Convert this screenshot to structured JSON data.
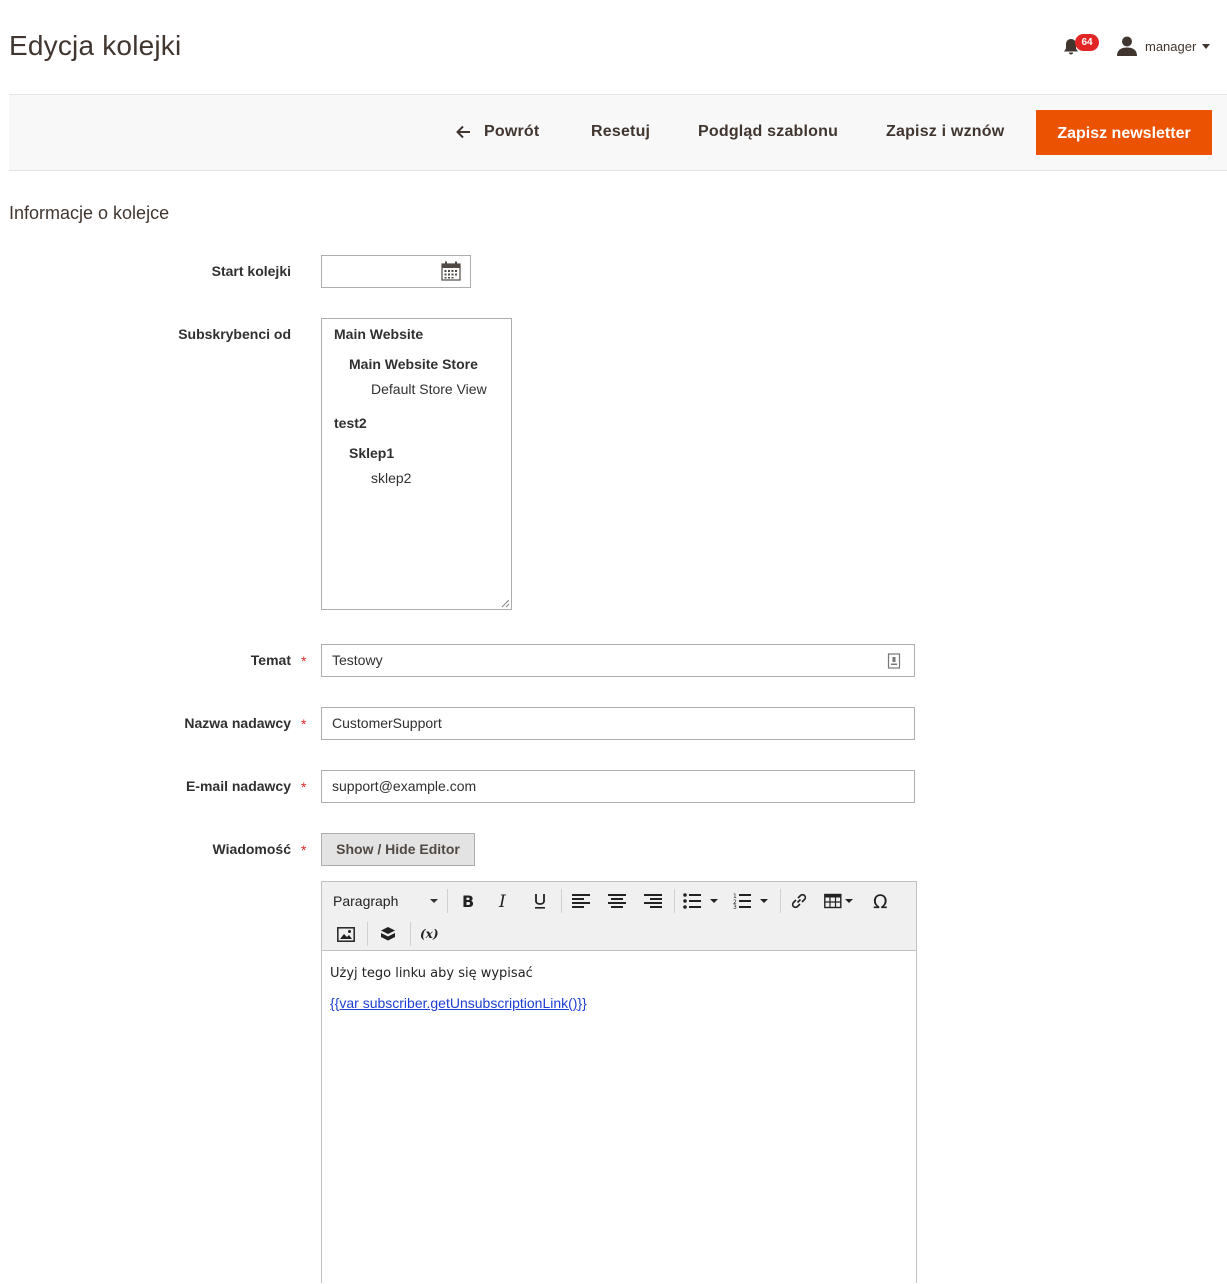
{
  "header": {
    "title": "Edycja kolejki",
    "notifications_count": "64",
    "user_name": "manager"
  },
  "actions": {
    "back": "Powrót",
    "reset": "Resetuj",
    "preview": "Podgląd szablonu",
    "save_continue": "Zapisz i wznów",
    "save_primary": "Zapisz newsletter"
  },
  "section": {
    "title": "Informacje o kolejce"
  },
  "form": {
    "queue_start": {
      "label": "Start kolejki",
      "value": ""
    },
    "subscribers_from": {
      "label": "Subskrybenci od",
      "items": [
        {
          "type": "website",
          "text": "Main Website"
        },
        {
          "type": "store",
          "text": "Main Website Store"
        },
        {
          "type": "view",
          "text": "Default Store View"
        },
        {
          "type": "website",
          "text": "test2"
        },
        {
          "type": "store",
          "text": "Sklep1"
        },
        {
          "type": "view",
          "text": "sklep2"
        }
      ]
    },
    "subject": {
      "label": "Temat",
      "value": "Testowy"
    },
    "sender_name": {
      "label": "Nazwa nadawcy",
      "value": "CustomerSupport"
    },
    "sender_email": {
      "label": "E-mail nadawcy",
      "value": "support@example.com"
    },
    "message": {
      "label": "Wiadomość",
      "toggle_label": "Show / Hide Editor"
    },
    "required_mark": "*"
  },
  "editor": {
    "format_value": "Paragraph",
    "toolbar_icons": [
      "bold-icon",
      "italic-icon",
      "underline-icon",
      "align-left-icon",
      "align-center-icon",
      "align-right-icon",
      "bullet-list-icon",
      "numbered-list-icon",
      "link-icon",
      "table-icon",
      "special-char-icon",
      "image-icon",
      "widget-icon",
      "variable-icon"
    ],
    "content_text": "Użyj tego linku aby się wypisać",
    "content_link": "{{var subscriber.getUnsubscriptionLink()}}"
  },
  "colors": {
    "primary": "#eb5202",
    "badge": "#e22626",
    "required": "#e22626",
    "link": "#1c3ed4"
  }
}
